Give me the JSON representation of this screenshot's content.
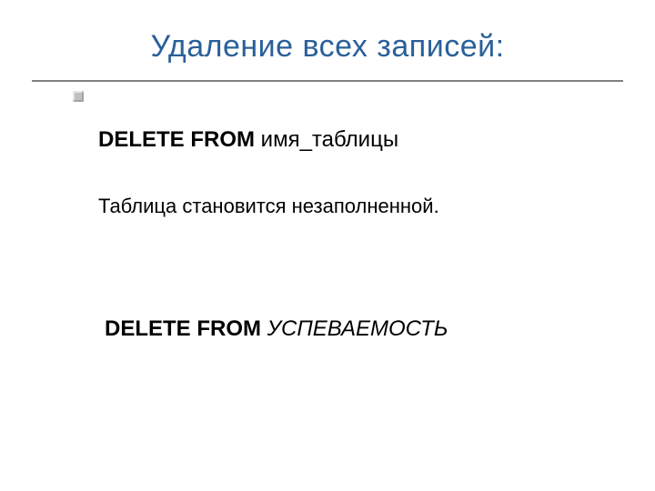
{
  "title": "Удаление всех записей:",
  "line1": {
    "keyword": "DELETE FROM",
    "rest": " имя_таблицы"
  },
  "line2": "Таблица становится незаполненной.",
  "line3": {
    "keyword": "DELETE FROM",
    "arg": " УСПЕВАЕМОСТЬ"
  }
}
